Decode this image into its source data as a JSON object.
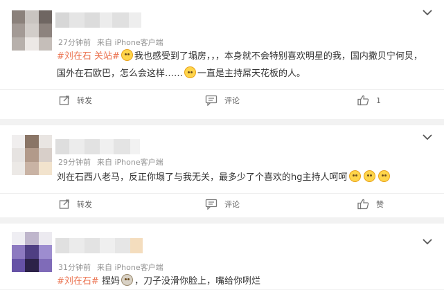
{
  "colors": {
    "page_bg": "#f2f2f2",
    "card_bg": "#ffffff",
    "topic_tag": "#eb7350",
    "meta_text": "#939393"
  },
  "posts": [
    {
      "meta_time": "27分钟前",
      "meta_source": "来自 iPhone客户端",
      "tag": "#刘在石 关站#",
      "text_a": "我也感受到了塌房，，，本身就不会特别喜欢明星的我，国内撒贝宁何炅，国外在石欧巴，怎么会这样……",
      "text_b": "一直是主持屌天花板的人。",
      "actions": {
        "repost": "转发",
        "comment": "评论",
        "like": "1"
      }
    },
    {
      "meta_time": "29分钟前",
      "meta_source": "来自 iPhone客户端",
      "tag": "",
      "text_a": "刘在石西八老马，反正你塌了与我无关，最多少了个喜欢的hg主持人呵呵",
      "text_b": "",
      "actions": {
        "repost": "转发",
        "comment": "评论",
        "like": "赞"
      }
    },
    {
      "meta_time": "31分钟前",
      "meta_source": "来自 iPhone客户端",
      "tag": "#刘在石#",
      "text_a": "捏妈",
      "text_b": "，刀子没滑你脸上，嘴给你咧烂",
      "actions": {}
    }
  ],
  "icons": {
    "dropdown": "chevron-down-icon",
    "repost": "repost-icon",
    "comment": "comment-icon",
    "like": "thumbs-up-icon"
  }
}
